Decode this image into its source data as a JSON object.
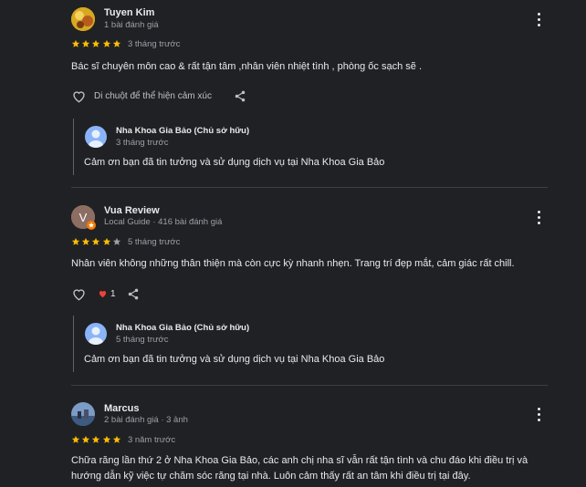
{
  "colors": {
    "star": "#fbbc04",
    "star_empty": "#9aa0a6",
    "heart": "#ea4335",
    "background": "#202124"
  },
  "reviews": [
    {
      "name": "Tuyen Kim",
      "meta": "1 bài đánh giá",
      "rating": 5,
      "date": "3 tháng trước",
      "text": "Bác sĩ chuyên môn cao & rất tận tâm ,nhân viên nhiệt tình , phòng ốc sạch sẽ .",
      "reaction_hint": "Di chuột để thể hiện cảm xúc",
      "owner_reply": {
        "name": "Nha Khoa Gia Bảo (Chủ sở hữu)",
        "date": "3 tháng trước",
        "text": "Cảm ơn bạn đã tin tưởng và sử dụng dịch vụ tại Nha Khoa Gia Bảo"
      }
    },
    {
      "name": "Vua Review",
      "avatar_letter": "V",
      "meta": "Local Guide · 416 bài đánh giá",
      "rating": 4,
      "date": "5 tháng trước",
      "text": "Nhân viên không những thân thiện mà còn cực kỳ nhanh nhẹn. Trang trí đẹp mắt, cảm giác rất chill.",
      "like_count": "1",
      "owner_reply": {
        "name": "Nha Khoa Gia Bảo (Chủ sở hữu)",
        "date": "5 tháng trước",
        "text": "Cảm ơn bạn đã tin tưởng và sử dụng dịch vụ tại Nha Khoa Gia Bảo"
      }
    },
    {
      "name": "Marcus",
      "meta": "2 bài đánh giá · 3 ảnh",
      "rating": 5,
      "date": "3 năm trước",
      "text_line1": "Chữa răng lần thứ 2 ở Nha Khoa Gia Bảo, các anh chị nha sĩ vẫn rất tận tình và chu đáo khi điều trị và",
      "text_line2": "hướng dẫn kỹ việc tự chăm sóc răng tại nhà. Luôn cảm thấy rất an tâm khi điều trị tại đây."
    }
  ]
}
